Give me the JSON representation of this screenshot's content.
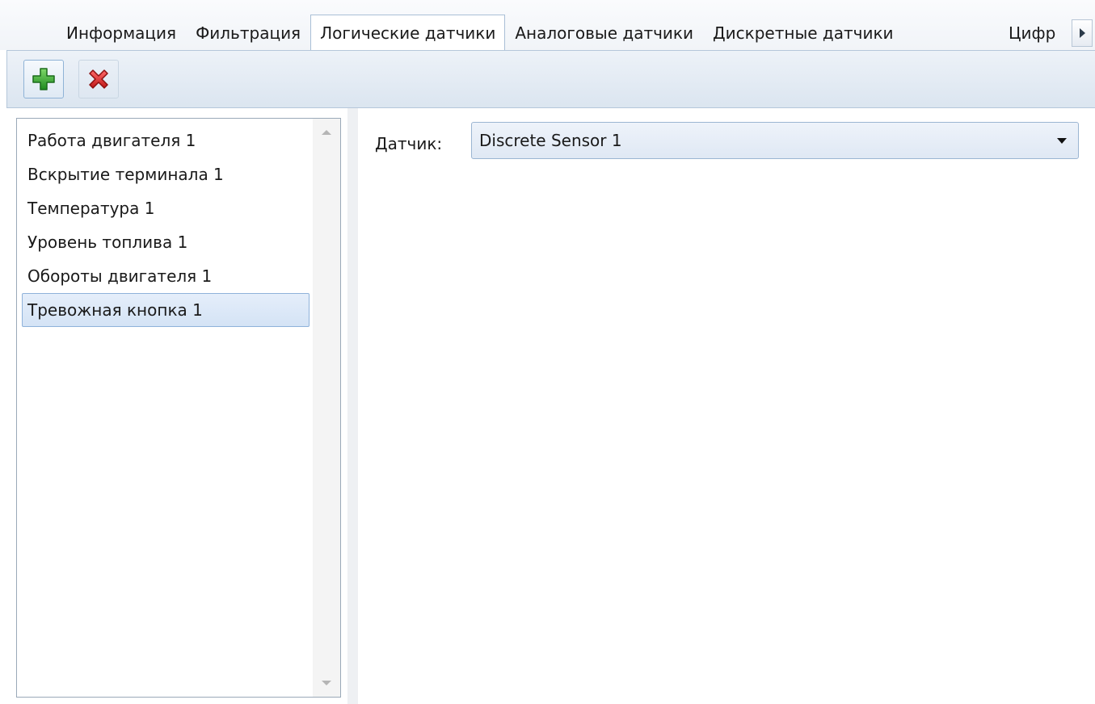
{
  "tabs": {
    "items": [
      {
        "label": "Информация"
      },
      {
        "label": "Фильтрация"
      },
      {
        "label": "Логические датчики",
        "active": true
      },
      {
        "label": "Аналоговые датчики"
      },
      {
        "label": "Дискретные датчики"
      }
    ],
    "clipped_label": "Цифр",
    "scroll_icon": "triangle-right-icon"
  },
  "toolbar": {
    "add_icon": "plus-icon",
    "delete_icon": "x-icon",
    "add_color": "#2ea02e",
    "delete_color": "#d42020"
  },
  "list": {
    "items": [
      {
        "label": "Работа двигателя 1"
      },
      {
        "label": "Вскрытие терминала 1"
      },
      {
        "label": "Температура 1"
      },
      {
        "label": "Уровень топлива 1"
      },
      {
        "label": "Обороты двигателя 1"
      },
      {
        "label": "Тревожная кнопка 1",
        "selected": true
      }
    ]
  },
  "form": {
    "sensor_label": "Датчик:",
    "sensor_value": "Discrete Sensor 1"
  }
}
